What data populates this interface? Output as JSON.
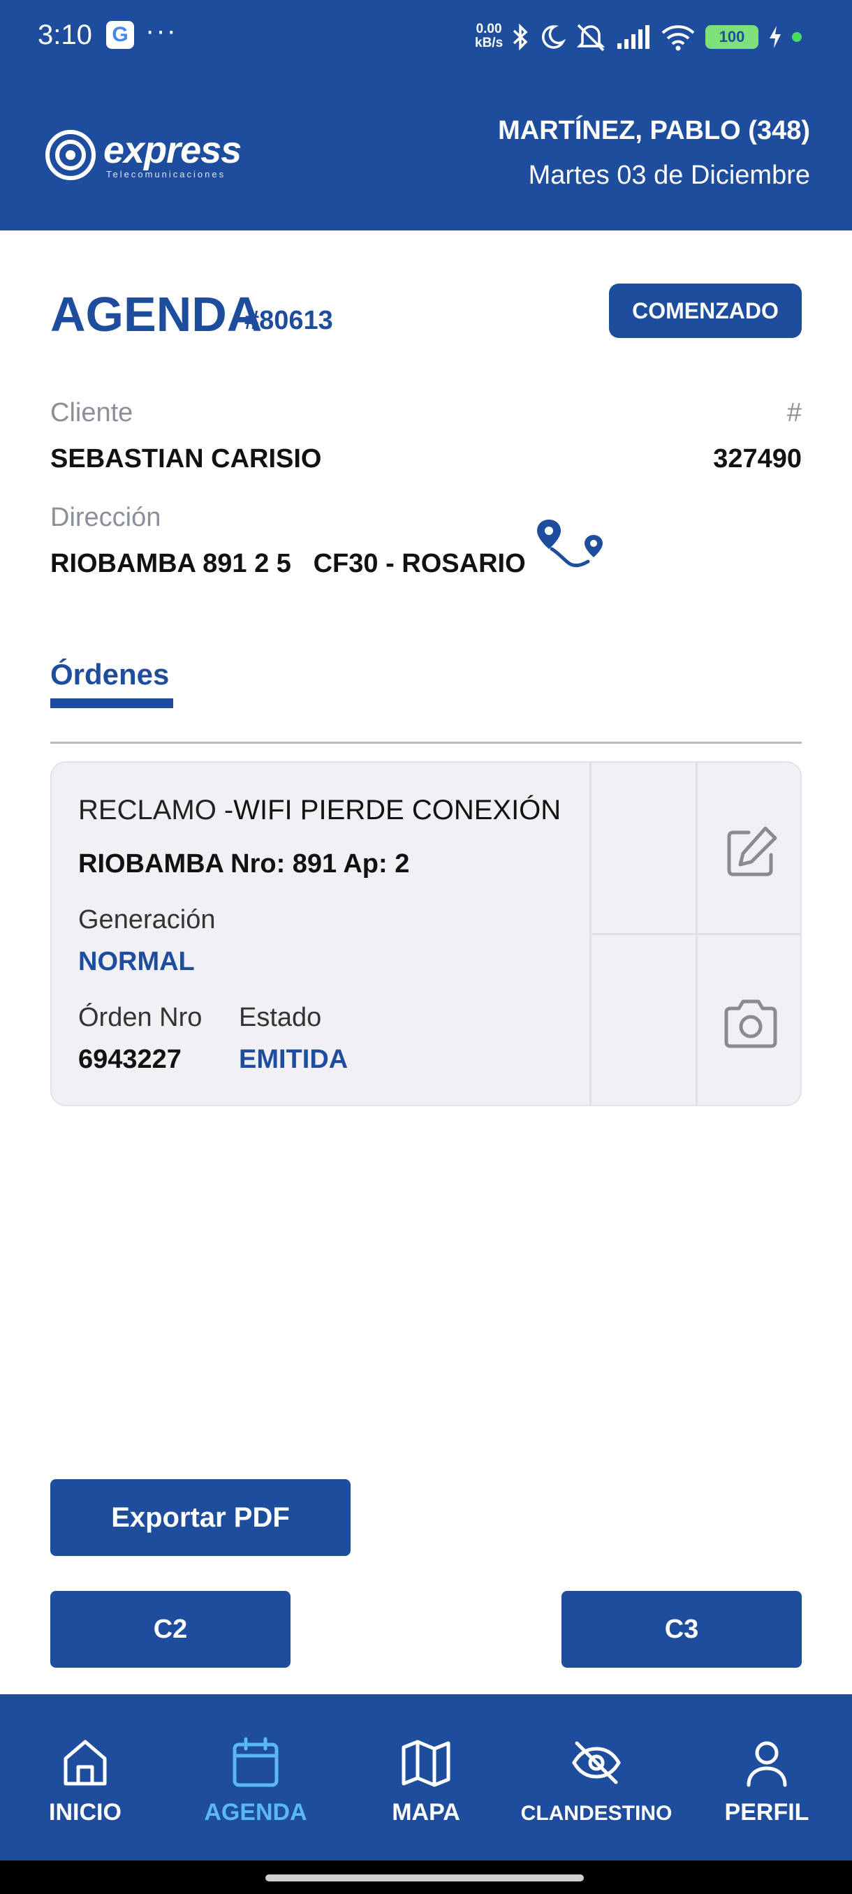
{
  "status_bar": {
    "time": "3:10",
    "google_icon": "G",
    "more": "···",
    "net_speed_value": "0.00",
    "net_speed_unit": "kB/s",
    "battery": "100",
    "icons": [
      "bluetooth-icon",
      "moon-icon",
      "mute-icon",
      "signal-icon",
      "wifi-icon",
      "battery-icon",
      "charging-icon"
    ]
  },
  "header": {
    "logo_word": "express",
    "logo_sub": "Telecomunicaciones",
    "user": "MARTÍNEZ, PABLO (348)",
    "date": "Martes 03 de Diciembre"
  },
  "agenda": {
    "title": "AGENDA",
    "number": "#80613",
    "status": "COMENZADO"
  },
  "client": {
    "label": "Cliente",
    "name": "SEBASTIAN CARISIO",
    "id_label": "#",
    "id": "327490",
    "address_label": "Dirección",
    "address": "RIOBAMBA 891 2 5   CF30 - ROSARIO"
  },
  "orders_tab": "Órdenes",
  "order": {
    "type": "RECLAMO -",
    "description": "WIFI PIERDE CONEXIÓN",
    "address": "RIOBAMBA Nro: 891 Ap: 2",
    "generation_label": "Generación",
    "generation": "NORMAL",
    "order_no_label": "Órden Nro",
    "order_no": "6943227",
    "state_label": "Estado",
    "state": "EMITIDA"
  },
  "actions": {
    "export_pdf": "Exportar PDF",
    "c2": "C2",
    "c3": "C3"
  },
  "nav": [
    {
      "label": "INICIO",
      "icon": "home-icon",
      "active": false
    },
    {
      "label": "AGENDA",
      "icon": "calendar-icon",
      "active": true
    },
    {
      "label": "MAPA",
      "icon": "map-icon",
      "active": false
    },
    {
      "label": "CLANDESTINO",
      "icon": "eye-off-icon",
      "active": false
    },
    {
      "label": "PERFIL",
      "icon": "user-icon",
      "active": false
    }
  ],
  "colors": {
    "brand": "#1e4d9e",
    "active_nav": "#5bb8f5",
    "card_bg": "#f0f0f5"
  }
}
